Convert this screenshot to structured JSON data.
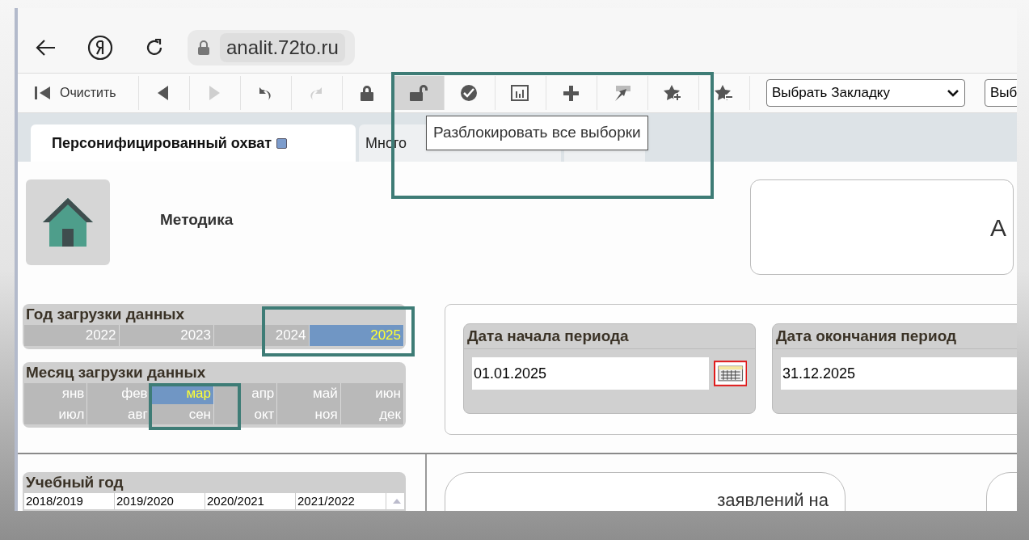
{
  "browser": {
    "url": "analit.72to.ru"
  },
  "toolbar": {
    "items": [
      {
        "kind": "clear",
        "label": "Очистить",
        "disabled": false,
        "hovered": false
      },
      {
        "kind": "back",
        "disabled": false,
        "hovered": false
      },
      {
        "kind": "forward",
        "disabled": true,
        "hovered": false
      },
      {
        "kind": "undo",
        "disabled": false,
        "hovered": false
      },
      {
        "kind": "redo",
        "disabled": true,
        "hovered": false
      },
      {
        "kind": "lock",
        "disabled": false,
        "hovered": false
      },
      {
        "kind": "unlock",
        "disabled": false,
        "hovered": true
      },
      {
        "kind": "check",
        "disabled": false,
        "hovered": false
      },
      {
        "kind": "chart",
        "disabled": false,
        "hovered": false
      },
      {
        "kind": "add",
        "disabled": false,
        "hovered": false
      },
      {
        "kind": "pointer",
        "disabled": false,
        "hovered": false
      },
      {
        "kind": "star_add",
        "disabled": false,
        "hovered": false
      },
      {
        "kind": "star_remove",
        "disabled": false,
        "hovered": false
      }
    ],
    "selects": [
      {
        "value": "Выбрать Закладку",
        "caret": true
      },
      {
        "value": "Выб",
        "caret": false
      }
    ]
  },
  "tooltip": "Разблокировать все выборки",
  "tabs": [
    {
      "label": "Персонифицированный охват",
      "selected": true
    },
    {
      "label": "Много",
      "selected": false
    },
    {
      "selected": false
    }
  ],
  "home": {
    "label": "Методика"
  },
  "right_card": {
    "text": "А"
  },
  "year_list": {
    "title": "Год загрузки данных",
    "items": [
      {
        "label": "2022",
        "selected": false
      },
      {
        "label": "2023",
        "selected": false
      },
      {
        "label": "2024",
        "selected": false
      },
      {
        "label": "2025",
        "selected": true
      }
    ]
  },
  "month_list": {
    "title": "Месяц загрузки данных",
    "items": [
      {
        "label": "янв",
        "selected": false
      },
      {
        "label": "фев",
        "selected": false
      },
      {
        "label": "мар",
        "selected": true
      },
      {
        "label": "апр",
        "selected": false
      },
      {
        "label": "май",
        "selected": false
      },
      {
        "label": "июн",
        "selected": false
      },
      {
        "label": "июл",
        "selected": false
      },
      {
        "label": "авг",
        "selected": false
      },
      {
        "label": "сен",
        "selected": false
      },
      {
        "label": "окт",
        "selected": false
      },
      {
        "label": "ноя",
        "selected": false
      },
      {
        "label": "дек",
        "selected": false
      }
    ]
  },
  "date_start": {
    "title": "Дата начала периода",
    "value": "01.01.2025"
  },
  "date_end": {
    "title": "Дата окончания период",
    "value": "31.12.2025"
  },
  "school_year": {
    "title": "Учебный год",
    "items": [
      "2018/2019",
      "2019/2020",
      "2020/2021",
      "2021/2022"
    ]
  },
  "info_card": {
    "text": "заявлений на"
  }
}
